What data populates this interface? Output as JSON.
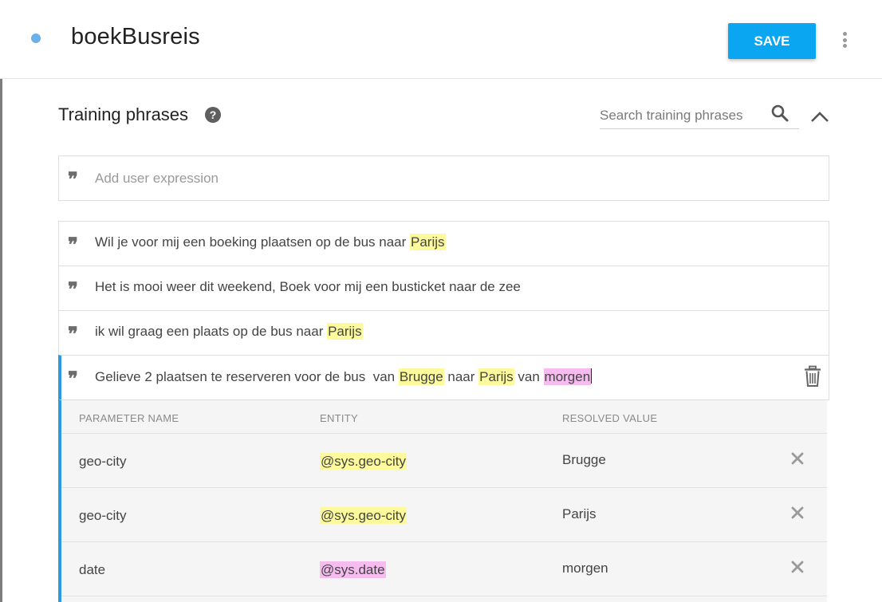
{
  "header": {
    "intent_name": "boekBusreis",
    "save_label": "SAVE"
  },
  "training": {
    "title": "Training phrases",
    "help_glyph": "?",
    "search_placeholder": "Search training phrases",
    "add_placeholder": "Add user expression",
    "quote_glyph": "❞",
    "phrases": [
      {
        "parts": [
          {
            "text": "Wil je voor mij een boeking plaatsen op de bus naar ",
            "hl": "none"
          },
          {
            "text": "Parijs",
            "hl": "yellow"
          }
        ]
      },
      {
        "parts": [
          {
            "text": "Het is mooi weer dit weekend, Boek voor mij een busticket naar de zee",
            "hl": "none"
          }
        ]
      },
      {
        "parts": [
          {
            "text": "ik wil graag een plaats op de bus naar ",
            "hl": "none"
          },
          {
            "text": "Parijs",
            "hl": "yellow"
          }
        ]
      },
      {
        "parts": [
          {
            "text": "Gelieve 2 plaatsen te reserveren voor de bus  van ",
            "hl": "none"
          },
          {
            "text": "Brugge",
            "hl": "yellow"
          },
          {
            "text": " naar ",
            "hl": "none"
          },
          {
            "text": "Parijs",
            "hl": "yellow"
          },
          {
            "text": " van ",
            "hl": "none"
          },
          {
            "text": "morgen",
            "hl": "pink"
          }
        ]
      }
    ]
  },
  "parameters": {
    "headers": {
      "name": "PARAMETER NAME",
      "entity": "ENTITY",
      "resolved": "RESOLVED VALUE"
    },
    "rows": [
      {
        "name": "geo-city",
        "entity": "@sys.geo-city",
        "entity_hl": "yellow",
        "resolved": "Brugge"
      },
      {
        "name": "geo-city",
        "entity": "@sys.geo-city",
        "entity_hl": "yellow",
        "resolved": "Parijs"
      },
      {
        "name": "date",
        "entity": "@sys.date",
        "entity_hl": "pink",
        "resolved": "morgen"
      }
    ]
  },
  "colors": {
    "accent": "#0aa6f1",
    "active_bar": "#2b9ae0",
    "highlight_yellow": "#fcfa9c",
    "highlight_pink": "#f6bcef",
    "status_dot": "#6cb0ea"
  },
  "icons": {
    "status": "status-dot",
    "more": "more-vert-icon",
    "help": "help-circle-icon",
    "search": "search-icon",
    "collapse": "chevron-up-icon",
    "quote": "quote-icon",
    "delete": "trash-icon",
    "remove": "close-icon"
  }
}
